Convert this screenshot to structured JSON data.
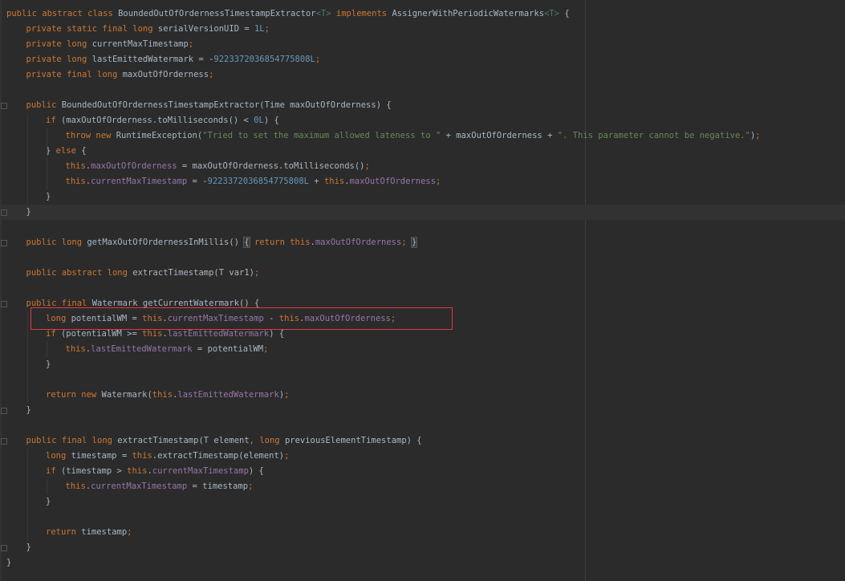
{
  "editor": {
    "language": "java",
    "selection_outline_color": "#e0393e",
    "lines": [
      {
        "indent": 0,
        "tokens": [
          [
            "kw",
            "public abstract class "
          ],
          [
            "plain",
            "BoundedOutOfOrdernessTimestampExtractor"
          ],
          [
            "tp",
            "<T>"
          ],
          [
            "kw",
            " implements "
          ],
          [
            "plain",
            "AssignerWithPeriodicWatermarks"
          ],
          [
            "tp",
            "<T>"
          ],
          [
            "plain",
            " {"
          ]
        ]
      },
      {
        "indent": 1,
        "tokens": [
          [
            "kw",
            "private static final long "
          ],
          [
            "plain",
            "serialVersionUID = "
          ],
          [
            "num",
            "1L"
          ],
          [
            "punc",
            ";"
          ]
        ]
      },
      {
        "indent": 1,
        "tokens": [
          [
            "kw",
            "private long "
          ],
          [
            "plain",
            "currentMaxTimestamp"
          ],
          [
            "punc",
            ";"
          ]
        ]
      },
      {
        "indent": 1,
        "tokens": [
          [
            "kw",
            "private long "
          ],
          [
            "plain",
            "lastEmittedWatermark = -"
          ],
          [
            "num",
            "9223372036854775808L"
          ],
          [
            "punc",
            ";"
          ]
        ]
      },
      {
        "indent": 1,
        "tokens": [
          [
            "kw",
            "private final long "
          ],
          [
            "plain",
            "maxOutOfOrderness"
          ],
          [
            "punc",
            ";"
          ]
        ]
      },
      {
        "indent": 0,
        "tokens": []
      },
      {
        "indent": 1,
        "tokens": [
          [
            "kw",
            "public "
          ],
          [
            "plain",
            "BoundedOutOfOrdernessTimestampExtractor(Time maxOutOfOrderness) {"
          ]
        ]
      },
      {
        "indent": 2,
        "tokens": [
          [
            "kw",
            "if "
          ],
          [
            "plain",
            "(maxOutOfOrderness.toMilliseconds() < "
          ],
          [
            "num",
            "0L"
          ],
          [
            "plain",
            ") {"
          ]
        ]
      },
      {
        "indent": 3,
        "tokens": [
          [
            "kw",
            "throw new "
          ],
          [
            "plain",
            "RuntimeException("
          ],
          [
            "str",
            "\"Tried to set the maximum allowed lateness to \""
          ],
          [
            "plain",
            " + maxOutOfOrderness + "
          ],
          [
            "str",
            "\". This parameter cannot be negative.\""
          ],
          [
            "plain",
            ")"
          ],
          [
            "punc",
            ";"
          ]
        ]
      },
      {
        "indent": 2,
        "tokens": [
          [
            "plain",
            "} "
          ],
          [
            "kw",
            "else "
          ],
          [
            "plain",
            "{"
          ]
        ]
      },
      {
        "indent": 3,
        "tokens": [
          [
            "kw",
            "this"
          ],
          [
            "plain",
            "."
          ],
          [
            "fld",
            "maxOutOfOrderness"
          ],
          [
            "plain",
            " = maxOutOfOrderness.toMilliseconds()"
          ],
          [
            "punc",
            ";"
          ]
        ]
      },
      {
        "indent": 3,
        "tokens": [
          [
            "kw",
            "this"
          ],
          [
            "plain",
            "."
          ],
          [
            "fld",
            "currentMaxTimestamp"
          ],
          [
            "plain",
            " = -"
          ],
          [
            "num",
            "9223372036854775808L"
          ],
          [
            "plain",
            " + "
          ],
          [
            "kw",
            "this"
          ],
          [
            "plain",
            "."
          ],
          [
            "fld",
            "maxOutOfOrderness"
          ],
          [
            "punc",
            ";"
          ]
        ]
      },
      {
        "indent": 2,
        "tokens": [
          [
            "plain",
            "}"
          ]
        ]
      },
      {
        "indent": 1,
        "tokens": [
          [
            "plain",
            "}"
          ]
        ],
        "current": true
      },
      {
        "indent": 0,
        "tokens": []
      },
      {
        "indent": 1,
        "tokens": [
          [
            "kw",
            "public long "
          ],
          [
            "plain",
            "getMaxOutOfOrdernessInMillis() "
          ],
          [
            "box",
            "{"
          ],
          [
            "plain",
            " "
          ],
          [
            "kw",
            "return this"
          ],
          [
            "plain",
            "."
          ],
          [
            "fld",
            "maxOutOfOrderness"
          ],
          [
            "punc",
            "; "
          ],
          [
            "box",
            "}"
          ]
        ]
      },
      {
        "indent": 0,
        "tokens": []
      },
      {
        "indent": 1,
        "tokens": [
          [
            "kw",
            "public abstract long "
          ],
          [
            "plain",
            "extractTimestamp(T var1)"
          ],
          [
            "punc",
            ";"
          ]
        ]
      },
      {
        "indent": 0,
        "tokens": []
      },
      {
        "indent": 1,
        "tokens": [
          [
            "kw",
            "public final "
          ],
          [
            "plain",
            "Watermark getCurrentWatermark() {"
          ]
        ]
      },
      {
        "indent": 2,
        "tokens": [
          [
            "kw",
            "long "
          ],
          [
            "plain",
            "potentialWM = "
          ],
          [
            "kw",
            "this"
          ],
          [
            "plain",
            "."
          ],
          [
            "fld",
            "currentMaxTimestamp"
          ],
          [
            "plain",
            " - "
          ],
          [
            "kw",
            "this"
          ],
          [
            "plain",
            "."
          ],
          [
            "fld",
            "maxOutOfOrderness"
          ],
          [
            "punc",
            ";"
          ]
        ]
      },
      {
        "indent": 2,
        "tokens": [
          [
            "kw",
            "if "
          ],
          [
            "plain",
            "(potentialWM >= "
          ],
          [
            "kw",
            "this"
          ],
          [
            "plain",
            "."
          ],
          [
            "fld",
            "lastEmittedWatermark"
          ],
          [
            "plain",
            ") {"
          ]
        ]
      },
      {
        "indent": 3,
        "tokens": [
          [
            "kw",
            "this"
          ],
          [
            "plain",
            "."
          ],
          [
            "fld",
            "lastEmittedWatermark"
          ],
          [
            "plain",
            " = potentialWM"
          ],
          [
            "punc",
            ";"
          ]
        ]
      },
      {
        "indent": 2,
        "tokens": [
          [
            "plain",
            "}"
          ]
        ]
      },
      {
        "indent": 0,
        "tokens": []
      },
      {
        "indent": 2,
        "tokens": [
          [
            "kw",
            "return new "
          ],
          [
            "plain",
            "Watermark("
          ],
          [
            "kw",
            "this"
          ],
          [
            "plain",
            "."
          ],
          [
            "fld",
            "lastEmittedWatermark"
          ],
          [
            "plain",
            ")"
          ],
          [
            "punc",
            ";"
          ]
        ]
      },
      {
        "indent": 1,
        "tokens": [
          [
            "plain",
            "}"
          ]
        ]
      },
      {
        "indent": 0,
        "tokens": []
      },
      {
        "indent": 1,
        "tokens": [
          [
            "kw",
            "public final long "
          ],
          [
            "plain",
            "extractTimestamp(T element"
          ],
          [
            "punc",
            ", "
          ],
          [
            "kw",
            "long "
          ],
          [
            "plain",
            "previousElementTimestamp) {"
          ]
        ]
      },
      {
        "indent": 2,
        "tokens": [
          [
            "kw",
            "long "
          ],
          [
            "plain",
            "timestamp = "
          ],
          [
            "kw",
            "this"
          ],
          [
            "plain",
            ".extractTimestamp(element)"
          ],
          [
            "punc",
            ";"
          ]
        ]
      },
      {
        "indent": 2,
        "tokens": [
          [
            "kw",
            "if "
          ],
          [
            "plain",
            "(timestamp > "
          ],
          [
            "kw",
            "this"
          ],
          [
            "plain",
            "."
          ],
          [
            "fld",
            "currentMaxTimestamp"
          ],
          [
            "plain",
            ") {"
          ]
        ]
      },
      {
        "indent": 3,
        "tokens": [
          [
            "kw",
            "this"
          ],
          [
            "plain",
            "."
          ],
          [
            "fld",
            "currentMaxTimestamp"
          ],
          [
            "plain",
            " = timestamp"
          ],
          [
            "punc",
            ";"
          ]
        ]
      },
      {
        "indent": 2,
        "tokens": [
          [
            "plain",
            "}"
          ]
        ]
      },
      {
        "indent": 0,
        "tokens": []
      },
      {
        "indent": 2,
        "tokens": [
          [
            "kw",
            "return "
          ],
          [
            "plain",
            "timestamp"
          ],
          [
            "punc",
            ";"
          ]
        ]
      },
      {
        "indent": 1,
        "tokens": [
          [
            "plain",
            "}"
          ]
        ]
      },
      {
        "indent": 0,
        "tokens": [
          [
            "plain",
            "}"
          ]
        ]
      }
    ]
  }
}
